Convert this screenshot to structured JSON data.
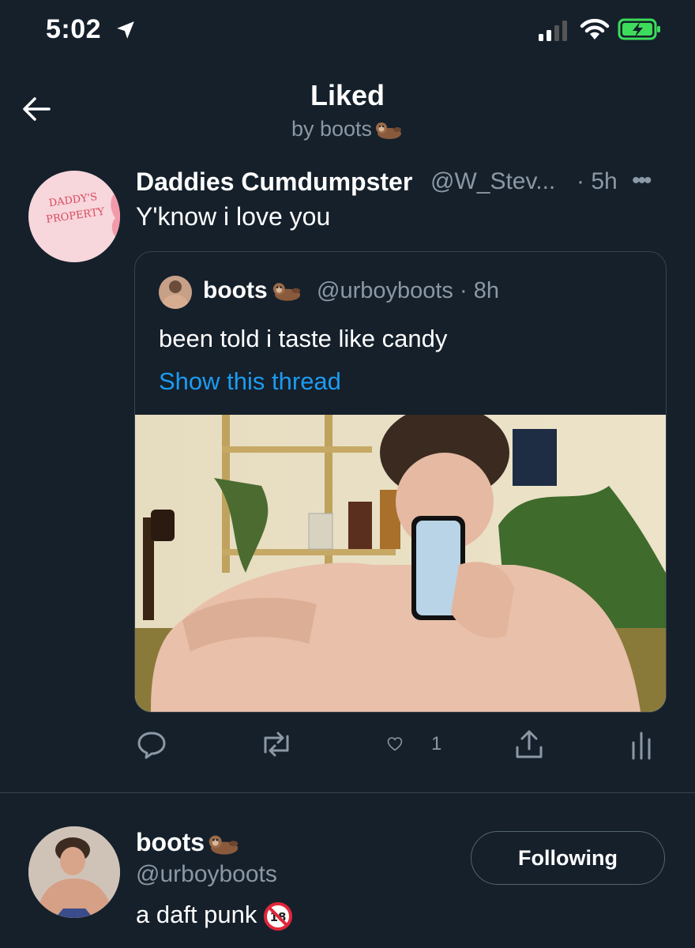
{
  "status_bar": {
    "time": "5:02"
  },
  "header": {
    "title": "Liked",
    "subtitle": "by boots"
  },
  "tweet": {
    "author_name": "Daddies Cumdumpster",
    "author_handle": "@W_Stev...",
    "time": "· 5h",
    "more": "•••",
    "text": "Y'know i love you",
    "avatar_text_line1": "DADDY'S",
    "avatar_text_line2": "PROPERTY",
    "quote": {
      "author_name": "boots",
      "author_handle": "@urboyboots · 8h",
      "text": "been told i taste like candy",
      "thread_link": "Show this thread"
    },
    "actions": {
      "like_count": "1"
    }
  },
  "user_card": {
    "name": "boots",
    "handle": "@urboyboots",
    "bio": "a daft punk",
    "follow_label": "Following"
  },
  "colors": {
    "background": "#15202b",
    "accent": "#1d9bf0",
    "secondary_text": "#8b98a5",
    "border": "#38444d"
  },
  "icons": [
    "location-arrow-icon",
    "signal-icon",
    "wifi-icon",
    "battery-charging-icon",
    "back-arrow-icon",
    "otter-icon",
    "reply-icon",
    "retweet-icon",
    "heart-icon",
    "share-icon",
    "analytics-icon",
    "no-under-18-icon"
  ]
}
